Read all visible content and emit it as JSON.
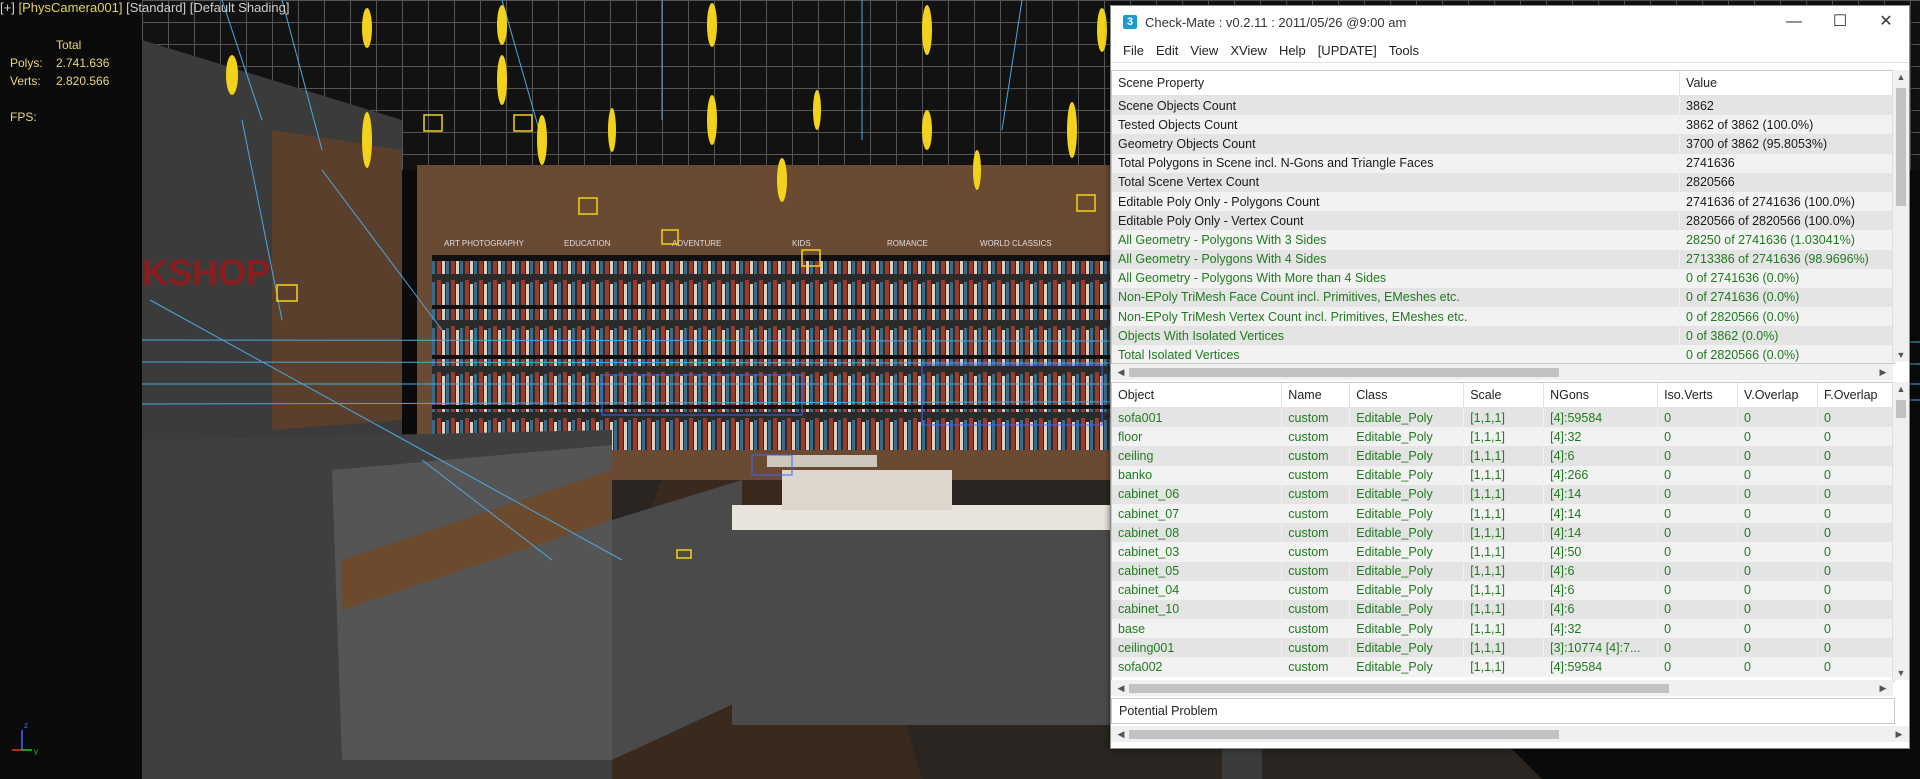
{
  "viewport": {
    "label_prefix": "[+]",
    "camera": "[PhysCamera001]",
    "mode": "[Standard]",
    "shading": "[Default Shading]",
    "stats": {
      "header": "Total",
      "polys_label": "Polys:",
      "polys_value": "2.741.636",
      "verts_label": "Verts:",
      "verts_value": "2.820.566",
      "fps_label": "FPS:"
    },
    "signs": [
      "ART PHOTOGRAPHY",
      "EDUCATION",
      "ADVENTURE",
      "KIDS",
      "ROMANCE",
      "WORLD CLASSICS"
    ],
    "store_sign": "KSHOP",
    "axis": {
      "y": "y",
      "z": "z"
    }
  },
  "window": {
    "icon": "3",
    "title": "Check-Mate : v0.2.11 : 2011/05/26 @9:00 am",
    "controls": {
      "minimize": "—",
      "maximize": "☐",
      "close": "✕"
    },
    "menu": [
      "File",
      "Edit",
      "View",
      "XView",
      "Help",
      "[UPDATE]",
      "Tools"
    ]
  },
  "scene_table": {
    "headers": [
      "Scene Property",
      "Value"
    ],
    "rows": [
      {
        "prop": "Scene Objects Count",
        "value": "3862",
        "color": "black"
      },
      {
        "prop": "Tested Objects Count",
        "value": "3862 of 3862 (100.0%)",
        "color": "black"
      },
      {
        "prop": "Geometry Objects Count",
        "value": "3700 of 3862 (95.8053%)",
        "color": "black"
      },
      {
        "prop": "Total Polygons in Scene incl. N-Gons and Triangle Faces",
        "value": "2741636",
        "color": "black"
      },
      {
        "prop": "Total Scene Vertex Count",
        "value": "2820566",
        "color": "black"
      },
      {
        "prop": "Editable Poly Only - Polygons Count",
        "value": "2741636 of 2741636 (100.0%)",
        "color": "black"
      },
      {
        "prop": "Editable Poly Only - Vertex Count",
        "value": "2820566 of 2820566 (100.0%)",
        "color": "black"
      },
      {
        "prop": "All Geometry - Polygons With 3 Sides",
        "value": "28250 of 2741636 (1.03041%)",
        "color": "green"
      },
      {
        "prop": "All Geometry - Polygons With 4 Sides",
        "value": "2713386 of 2741636 (98.9696%)",
        "color": "green"
      },
      {
        "prop": "All Geometry - Polygons With More than 4 Sides",
        "value": "0 of 2741636 (0.0%)",
        "color": "green"
      },
      {
        "prop": "Non-EPoly TriMesh Face Count incl. Primitives, EMeshes etc.",
        "value": "0 of 2741636 (0.0%)",
        "color": "green"
      },
      {
        "prop": "Non-EPoly TriMesh Vertex Count incl. Primitives, EMeshes etc.",
        "value": "0 of 2820566 (0.0%)",
        "color": "green"
      },
      {
        "prop": "Objects With Isolated Vertices",
        "value": "0 of 3862 (0.0%)",
        "color": "green"
      },
      {
        "prop": "Total Isolated Vertices",
        "value": "0 of 2820566 (0.0%)",
        "color": "green"
      }
    ]
  },
  "object_table": {
    "headers": [
      "Object",
      "Name",
      "Class",
      "Scale",
      "NGons",
      "Iso.Verts",
      "V.Overlap",
      "F.Overlap"
    ],
    "rows": [
      [
        "sofa001",
        "custom",
        "Editable_Poly",
        "[1,1,1]",
        "[4]:59584",
        "0",
        "0",
        "0"
      ],
      [
        "floor",
        "custom",
        "Editable_Poly",
        "[1,1,1]",
        "[4]:32",
        "0",
        "0",
        "0"
      ],
      [
        "ceiling",
        "custom",
        "Editable_Poly",
        "[1,1,1]",
        "[4]:6",
        "0",
        "0",
        "0"
      ],
      [
        "banko",
        "custom",
        "Editable_Poly",
        "[1,1,1]",
        "[4]:266",
        "0",
        "0",
        "0"
      ],
      [
        "cabinet_06",
        "custom",
        "Editable_Poly",
        "[1,1,1]",
        "[4]:14",
        "0",
        "0",
        "0"
      ],
      [
        "cabinet_07",
        "custom",
        "Editable_Poly",
        "[1,1,1]",
        "[4]:14",
        "0",
        "0",
        "0"
      ],
      [
        "cabinet_08",
        "custom",
        "Editable_Poly",
        "[1,1,1]",
        "[4]:14",
        "0",
        "0",
        "0"
      ],
      [
        "cabinet_03",
        "custom",
        "Editable_Poly",
        "[1,1,1]",
        "[4]:50",
        "0",
        "0",
        "0"
      ],
      [
        "cabinet_05",
        "custom",
        "Editable_Poly",
        "[1,1,1]",
        "[4]:6",
        "0",
        "0",
        "0"
      ],
      [
        "cabinet_04",
        "custom",
        "Editable_Poly",
        "[1,1,1]",
        "[4]:6",
        "0",
        "0",
        "0"
      ],
      [
        "cabinet_10",
        "custom",
        "Editable_Poly",
        "[1,1,1]",
        "[4]:6",
        "0",
        "0",
        "0"
      ],
      [
        "base",
        "custom",
        "Editable_Poly",
        "[1,1,1]",
        "[4]:32",
        "0",
        "0",
        "0"
      ],
      [
        "ceiling001",
        "custom",
        "Editable_Poly",
        "[1,1,1]",
        "[3]:10774 [4]:7...",
        "0",
        "0",
        "0"
      ],
      [
        "sofa002",
        "custom",
        "Editable_Poly",
        "[1,1,1]",
        "[4]:59584",
        "0",
        "0",
        "0"
      ]
    ]
  },
  "potential_problem": {
    "label": "Potential Problem"
  },
  "colors": {
    "green_text": "#1f7a1f",
    "stats_yellow": "#e8d77a",
    "light_yellow": "#f2d21a",
    "helper_blue": "#4aa8e0"
  }
}
